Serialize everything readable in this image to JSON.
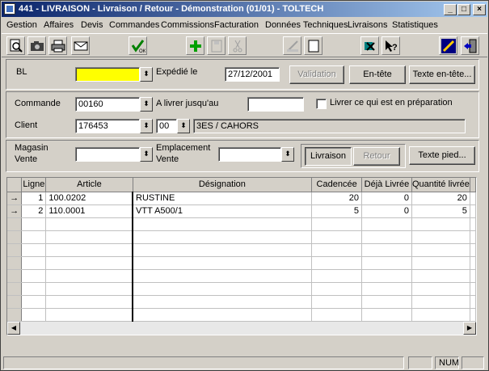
{
  "window": {
    "title": "441 - LIVRAISON - Livraison / Retour - Démonstration (01/01) - TOLTECH"
  },
  "menu": [
    "Gestion",
    "Affaires",
    "Devis",
    "Commandes",
    "Commissions",
    "Facturation",
    "Données Techniques",
    "Livraisons",
    "Statistiques"
  ],
  "toolbar": {
    "icons": [
      "preview-icon",
      "camera-icon",
      "printer-icon",
      "envelope-icon",
      "validate-ok-icon",
      "add-icon",
      "save-icon",
      "cut-icon",
      "edit-icon",
      "new-page-icon",
      "transfer-icon",
      "help-icon",
      "tool-icon",
      "exit-icon"
    ]
  },
  "header": {
    "bl_label": "BL",
    "bl_value": "",
    "expedie_label": "Expédié le",
    "expedie_value": "27/12/2001",
    "validation_button": "Validation",
    "entete_button": "En-tête",
    "texte_entete_button": "Texte en-tête..."
  },
  "order": {
    "commande_label": "Commande",
    "commande_value": "00160",
    "livrer_label": "A livrer jusqu'au",
    "livrer_value": "",
    "livrer_prep_label": "Livrer ce qui est en préparation",
    "client_label": "Client",
    "client_value": "176453",
    "client_suffix": "00",
    "client_name": "3ES / CAHORS"
  },
  "location": {
    "magasin_label_1": "Magasin",
    "magasin_label_2": "Vente",
    "magasin_value": "",
    "emplacement_label_1": "Emplacement",
    "emplacement_label_2": "Vente",
    "emplacement_value": "",
    "livraison_button": "Livraison",
    "retour_button": "Retour",
    "texte_pied_button": "Texte pied..."
  },
  "grid": {
    "columns": [
      "Ligne",
      "Article",
      "Désignation",
      "Cadencée",
      "Déjà Livrée",
      "Quantité livrée"
    ],
    "rows": [
      {
        "arrow": "→",
        "ligne": "1",
        "article": "100.0202",
        "designation": "RUSTINE",
        "cadencee": "20",
        "deja": "0",
        "qte": "20"
      },
      {
        "arrow": "→",
        "ligne": "2",
        "article": "110.0001",
        "designation": "VTT A500/1",
        "cadencee": "5",
        "deja": "0",
        "qte": "5"
      }
    ]
  },
  "status": {
    "num": "NUM"
  }
}
